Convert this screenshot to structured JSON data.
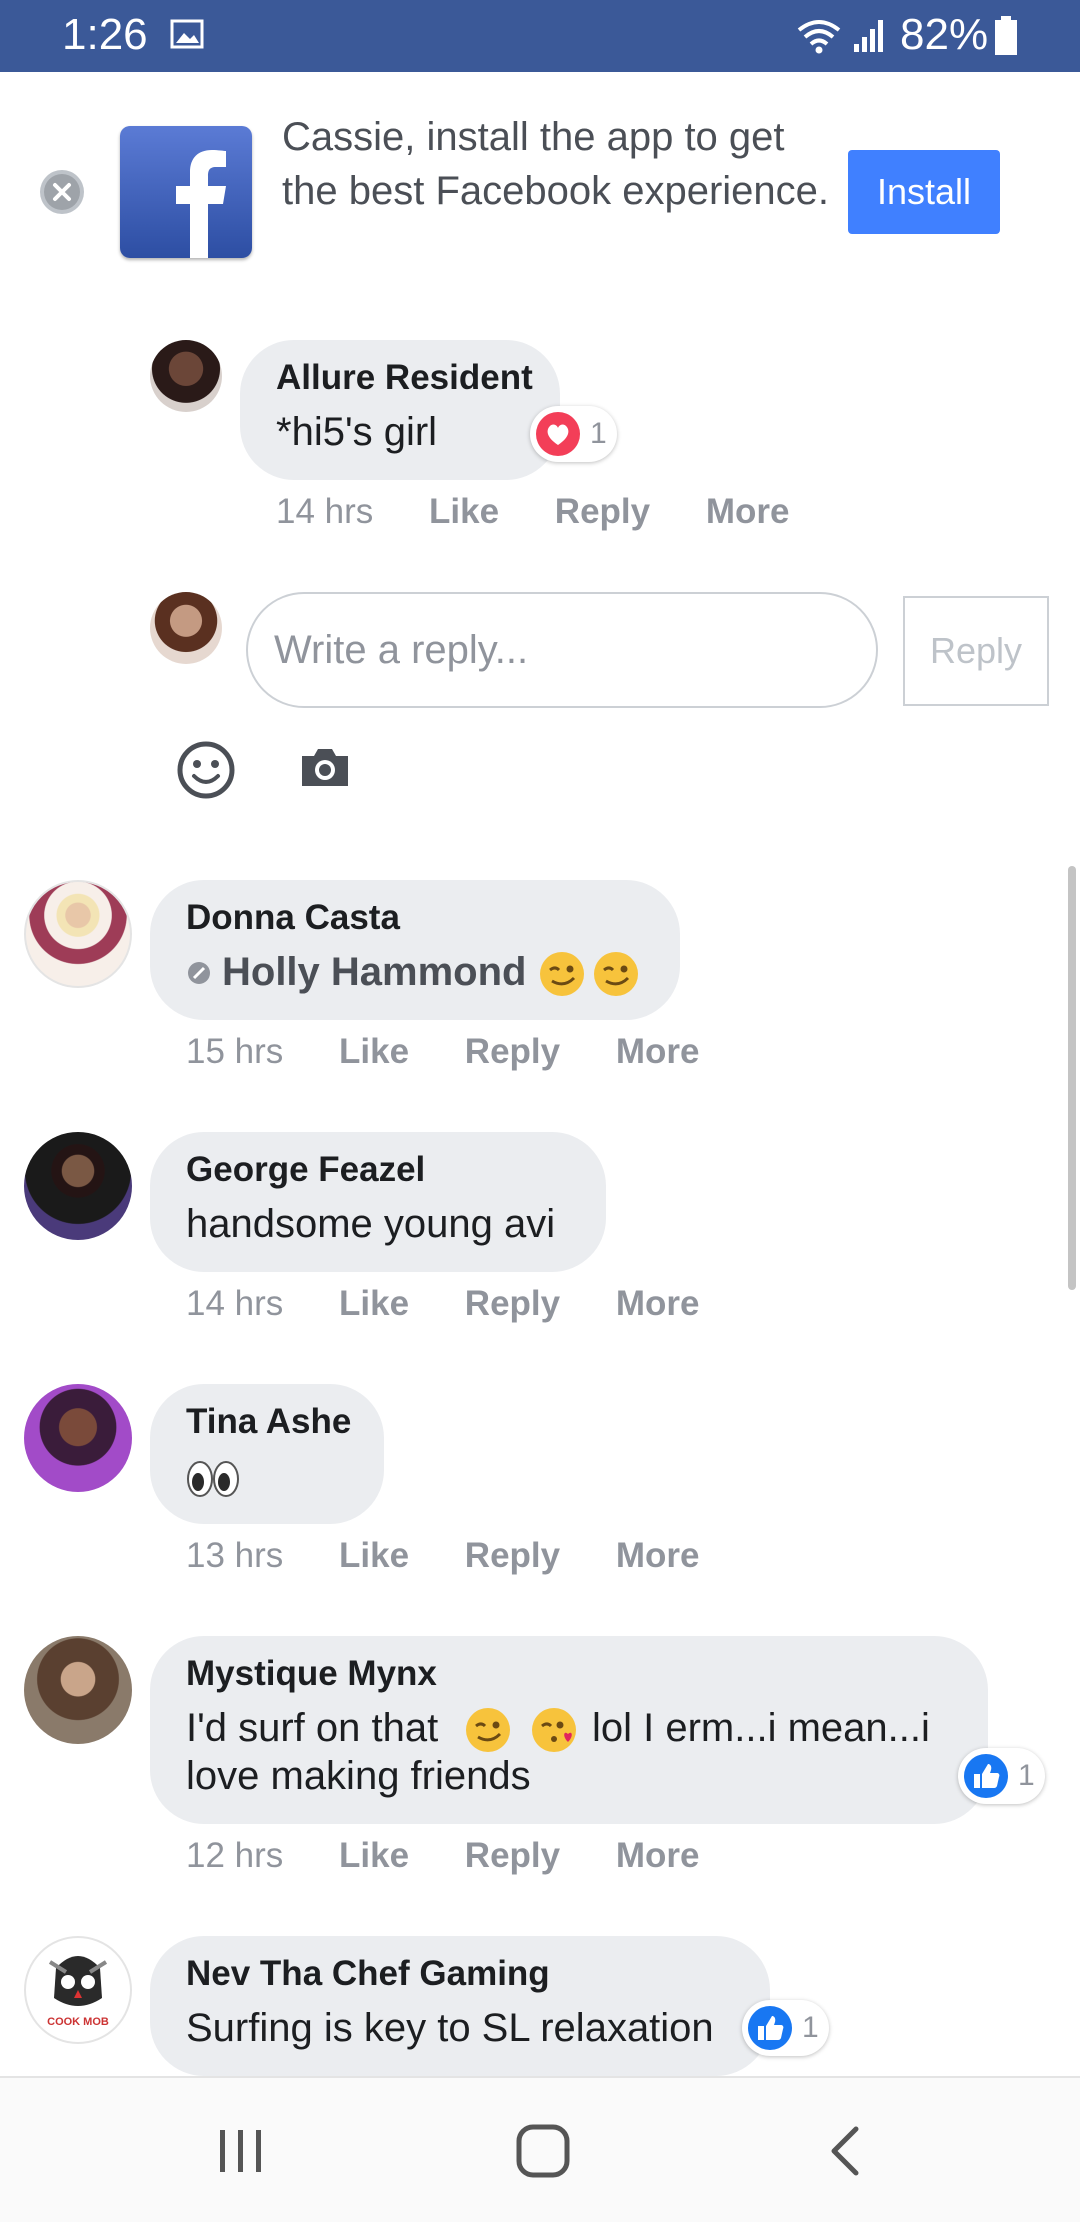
{
  "status_bar": {
    "time": "1:26",
    "battery": "82%"
  },
  "banner": {
    "text": "Cassie, install the app to get the best Facebook experience.",
    "install_label": "Install"
  },
  "comments": [
    {
      "name": "Allure Resident",
      "text": "*hi5's girl",
      "time": "14 hrs",
      "reaction": "heart",
      "reaction_count": "1"
    },
    {
      "name": "Donna Casta",
      "mention": "Holly Hammond",
      "time": "15 hrs"
    },
    {
      "name": "George Feazel",
      "text": "handsome young avi",
      "time": "14 hrs"
    },
    {
      "name": "Tina Ashe",
      "time": "13 hrs"
    },
    {
      "name": "Mystique Mynx",
      "line1": "I'd surf on that",
      "line1b": "lol I erm...i mean...i",
      "line2": "love making friends",
      "time": "12 hrs",
      "reaction": "like",
      "reaction_count": "1"
    },
    {
      "name": "Nev Tha Chef Gaming",
      "text": "Surfing is key to SL relaxation",
      "reaction": "like",
      "reaction_count": "1",
      "avatar_caption": "COOK MOB"
    }
  ],
  "actions": {
    "like": "Like",
    "reply": "Reply",
    "more": "More"
  },
  "composer": {
    "placeholder": "Write a reply...",
    "submit_label": "Reply"
  },
  "colors": {
    "facebook_blue": "#3b5998",
    "install_blue": "#4080ff",
    "bubble_gray": "#ebedf0",
    "meta_gray": "#90949c"
  }
}
